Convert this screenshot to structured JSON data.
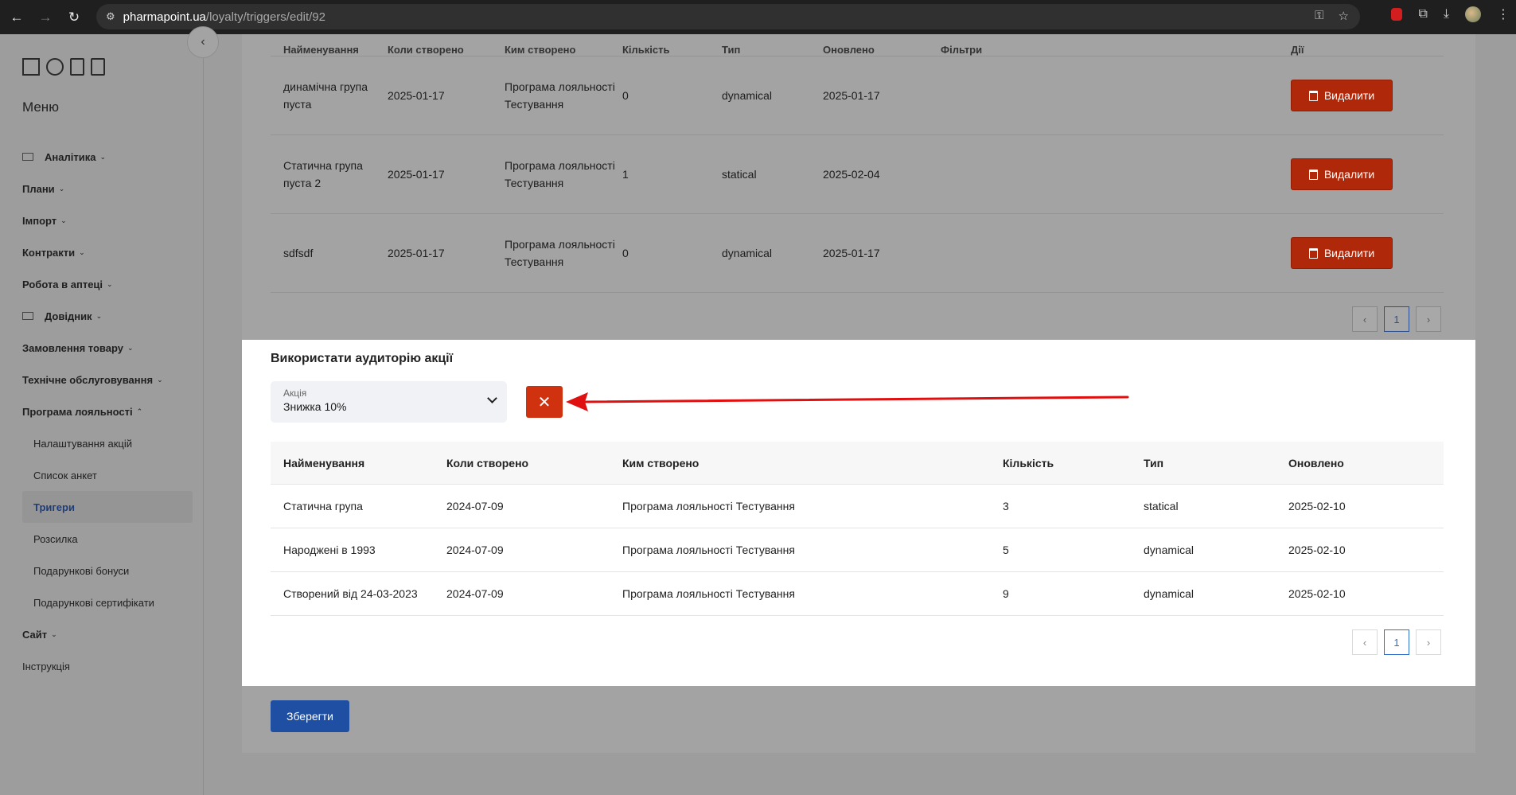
{
  "browser": {
    "url_host": "pharmapoint.ua",
    "url_path": "/loyalty/triggers/edit/92"
  },
  "sidebar": {
    "menu_title": "Меню",
    "items": [
      {
        "label": "Аналітика",
        "caret": "⌄"
      },
      {
        "label": "Плани",
        "caret": "⌄"
      },
      {
        "label": "Імпорт",
        "caret": "⌄"
      },
      {
        "label": "Контракти",
        "caret": "⌄"
      },
      {
        "label": "Робота в аптеці",
        "caret": "⌄"
      },
      {
        "label": "Довідник",
        "caret": "⌄"
      },
      {
        "label": "Замовлення товару",
        "caret": "⌄"
      },
      {
        "label": "Технічне обслуговування",
        "caret": "⌄"
      },
      {
        "label": "Програма лояльності",
        "caret": "⌃"
      }
    ],
    "sub_items": [
      {
        "label": "Налаштування акцій"
      },
      {
        "label": "Список анкет"
      },
      {
        "label": "Тригери"
      },
      {
        "label": "Розсилка"
      },
      {
        "label": "Подарункові бонуси"
      },
      {
        "label": "Подарункові сертифікати"
      }
    ],
    "after_items": [
      {
        "label": "Сайт",
        "caret": "⌄"
      },
      {
        "label": "Інструкція"
      }
    ]
  },
  "top_table": {
    "headers": [
      "Найменування",
      "Коли створено",
      "Ким створено",
      "Кількість",
      "Тип",
      "Оновлено",
      "Фільтри",
      "Дії"
    ],
    "delete_label": "Видалити",
    "rows": [
      {
        "name": "динамічна група пуста",
        "created": "2025-01-17",
        "creator": "Програма лояльності Тестування",
        "count": "0",
        "type": "dynamical",
        "updated": "2025-01-17"
      },
      {
        "name": "Статична група пуста 2",
        "created": "2025-01-17",
        "creator": "Програма лояльності Тестування",
        "count": "1",
        "type": "statical",
        "updated": "2025-02-04"
      },
      {
        "name": "sdfsdf",
        "created": "2025-01-17",
        "creator": "Програма лояльності Тестування",
        "count": "0",
        "type": "dynamical",
        "updated": "2025-01-17"
      }
    ],
    "page": "1"
  },
  "audience": {
    "title": "Використати аудиторію акції",
    "select_label": "Акція",
    "select_value": "Знижка 10%",
    "headers": [
      "Найменування",
      "Коли створено",
      "Ким створено",
      "Кількість",
      "Тип",
      "Оновлено"
    ],
    "rows": [
      {
        "name": "Статична група",
        "created": "2024-07-09",
        "creator": "Програма лояльності Тестування",
        "count": "3",
        "type": "statical",
        "updated": "2025-02-10"
      },
      {
        "name": "Народжені в 1993",
        "created": "2024-07-09",
        "creator": "Програма лояльності Тестування",
        "count": "5",
        "type": "dynamical",
        "updated": "2025-02-10"
      },
      {
        "name": "Створений від 24-03-2023",
        "created": "2024-07-09",
        "creator": "Програма лояльності Тестування",
        "count": "9",
        "type": "dynamical",
        "updated": "2025-02-10"
      }
    ],
    "page": "1"
  },
  "save_label": "Зберегти",
  "colors": {
    "danger": "#b0280a",
    "primary": "#1e4fa3",
    "annotation_arrow": "#e01010"
  }
}
